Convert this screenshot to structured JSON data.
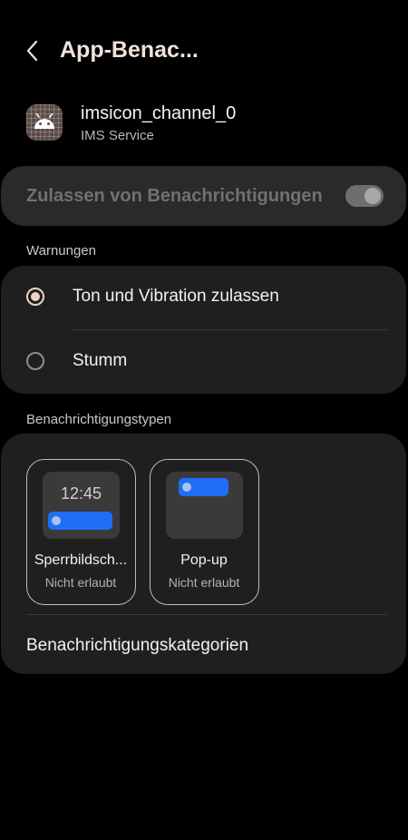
{
  "header": {
    "title": "App-Benac..."
  },
  "app": {
    "name": "imsicon_channel_0",
    "subtitle": "IMS Service"
  },
  "allow": {
    "label": "Zulassen von Benachrichtigungen",
    "enabled": true,
    "disabled_look": true
  },
  "warnings": {
    "section_label": "Warnungen",
    "options": [
      {
        "label": "Ton und Vibration zulassen",
        "selected": true
      },
      {
        "label": "Stumm",
        "selected": false
      }
    ]
  },
  "types": {
    "section_label": "Benachrichtigungstypen",
    "tiles": [
      {
        "title": "Sperrbildsch...",
        "status": "Nicht erlaubt",
        "preview_time": "12:45"
      },
      {
        "title": "Pop-up",
        "status": "Nicht erlaubt"
      }
    ],
    "categories_label": "Benachrichtigungskategorien"
  },
  "colors": {
    "background": "#000000",
    "card": "#1f1f1f",
    "accent": "#efd3c6",
    "notification_blue": "#1f6ef5"
  }
}
